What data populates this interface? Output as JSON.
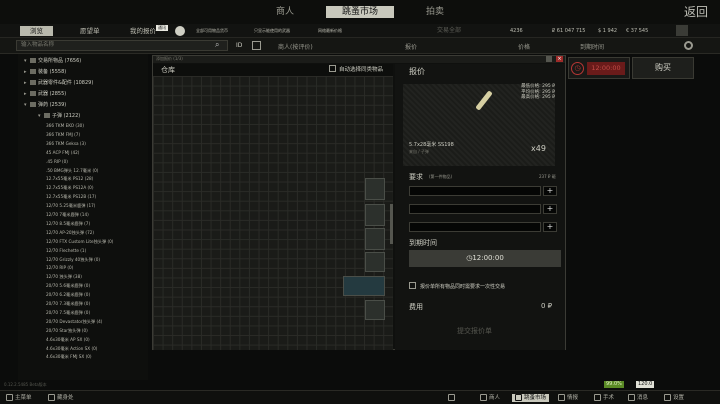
{
  "topnav": {
    "tabs": [
      "商人",
      "跳蚤市场",
      "拍卖"
    ],
    "active_tab": "跳蚤市场",
    "back": "返回"
  },
  "subnav": {
    "items": [
      "浏览",
      "愿望单",
      "我的报价"
    ],
    "active": "浏览",
    "pill_tags": [
      "通讯",
      "全部可用物品货币",
      "只显示能使用的武器",
      "网络最新价格",
      "交易全部"
    ],
    "wallet": {
      "count": "4236",
      "rub": "₽ 61 047 715",
      "usd": "$ 1 942",
      "eur": "€ 37 545"
    }
  },
  "filters": {
    "search_placeholder": "输入物品名称",
    "headers": [
      "商人(按评价)",
      "报价",
      "价格",
      "到期时间"
    ]
  },
  "sidebar": {
    "categories": [
      {
        "label": "交易所物品 (7656)",
        "indent": 0
      },
      {
        "label": "装备 (5558)",
        "indent": 0
      },
      {
        "label": "武器零件&配件 (10829)",
        "indent": 0
      },
      {
        "label": "武器 (2855)",
        "indent": 0
      },
      {
        "label": "弹药 (2539)",
        "indent": 0
      },
      {
        "label": "子弹 (2122)",
        "indent": 1
      }
    ],
    "ammo": [
      "366 TKM EKO (30)",
      "366 TKM FMJ (7)",
      "366 TKM Geksa (3)",
      "45 ACP FMJ (42)",
      ".45 RIP (0)",
      ".50 BMG弹头 12.7毫米 (0)",
      "12.7x55毫米 PS12 (28)",
      "12.7x55毫米 PS12A (0)",
      "12.7x55毫米 PS12B (17)",
      "12/70 5.25毫米鹿弹 (17)",
      "12/70 7毫米鹿弹 (14)",
      "12/70 8.5毫米鹿弹 (7)",
      "12/70 AP-20独头弹 (72)",
      "12/70 FTX Custom Lite独头弹 (0)",
      "12/70 Flechette (1)",
      "12/70 Grizzly 40独头弹 (0)",
      "12/70 RIP (0)",
      "12/70 独头弹 (38)",
      "20/70 5.6毫米鹿弹 (0)",
      "20/70 6.2毫米鹿弹 (0)",
      "20/70 7.3毫米鹿弹 (0)",
      "20/70 7.5毫米鹿弹 (0)",
      "20/70 Devastator独头弹 (4)",
      "20/70 Star独头弹 (0)",
      "4.6x30毫米 AP SX (0)",
      "4.6x30毫米 Action SX (0)",
      "4.6x30毫米 FMJ SX (0)"
    ]
  },
  "dialog": {
    "header": "添加报价 (1/3)",
    "inventory_title": "仓库",
    "autoselect": "自动选择同类物品",
    "offer_title": "报价",
    "prices": [
      {
        "label": "最低价格:",
        "value": "295 ₽"
      },
      {
        "label": "平均价格:",
        "value": "295 ₽"
      },
      {
        "label": "最高价格:",
        "value": "295 ₽"
      }
    ],
    "item_name": "5.7x28毫米 SS198",
    "item_sub": "来自 / 子弹",
    "item_qty": "x49",
    "requirements": "要求",
    "req_sub": "(第一件物品)",
    "req_value": "237 ₽ 砸",
    "expiry_title": "到期时间",
    "expiry_value": "12:00:00",
    "sell_all": "报价单所有物品同时需要求一次性交易",
    "fee_label": "费用",
    "fee_value": "0 ₽",
    "submit": "提交报价单"
  },
  "timer": {
    "value": "12:00:00"
  },
  "buy": "购买",
  "bottombar": {
    "items": [
      "主菜单",
      "藏身处",
      "角色",
      "商人",
      "跳蚤市场",
      "情报",
      "手术",
      "消息",
      "设置"
    ],
    "active": "跳蚤市场",
    "version": "0.12.2.5485 Beta版本",
    "badges": [
      "99.0%",
      "120.0"
    ]
  },
  "colors": {
    "accent_red": "#b73634",
    "panel": "#121311",
    "active_tab": "#c8c8bc"
  }
}
